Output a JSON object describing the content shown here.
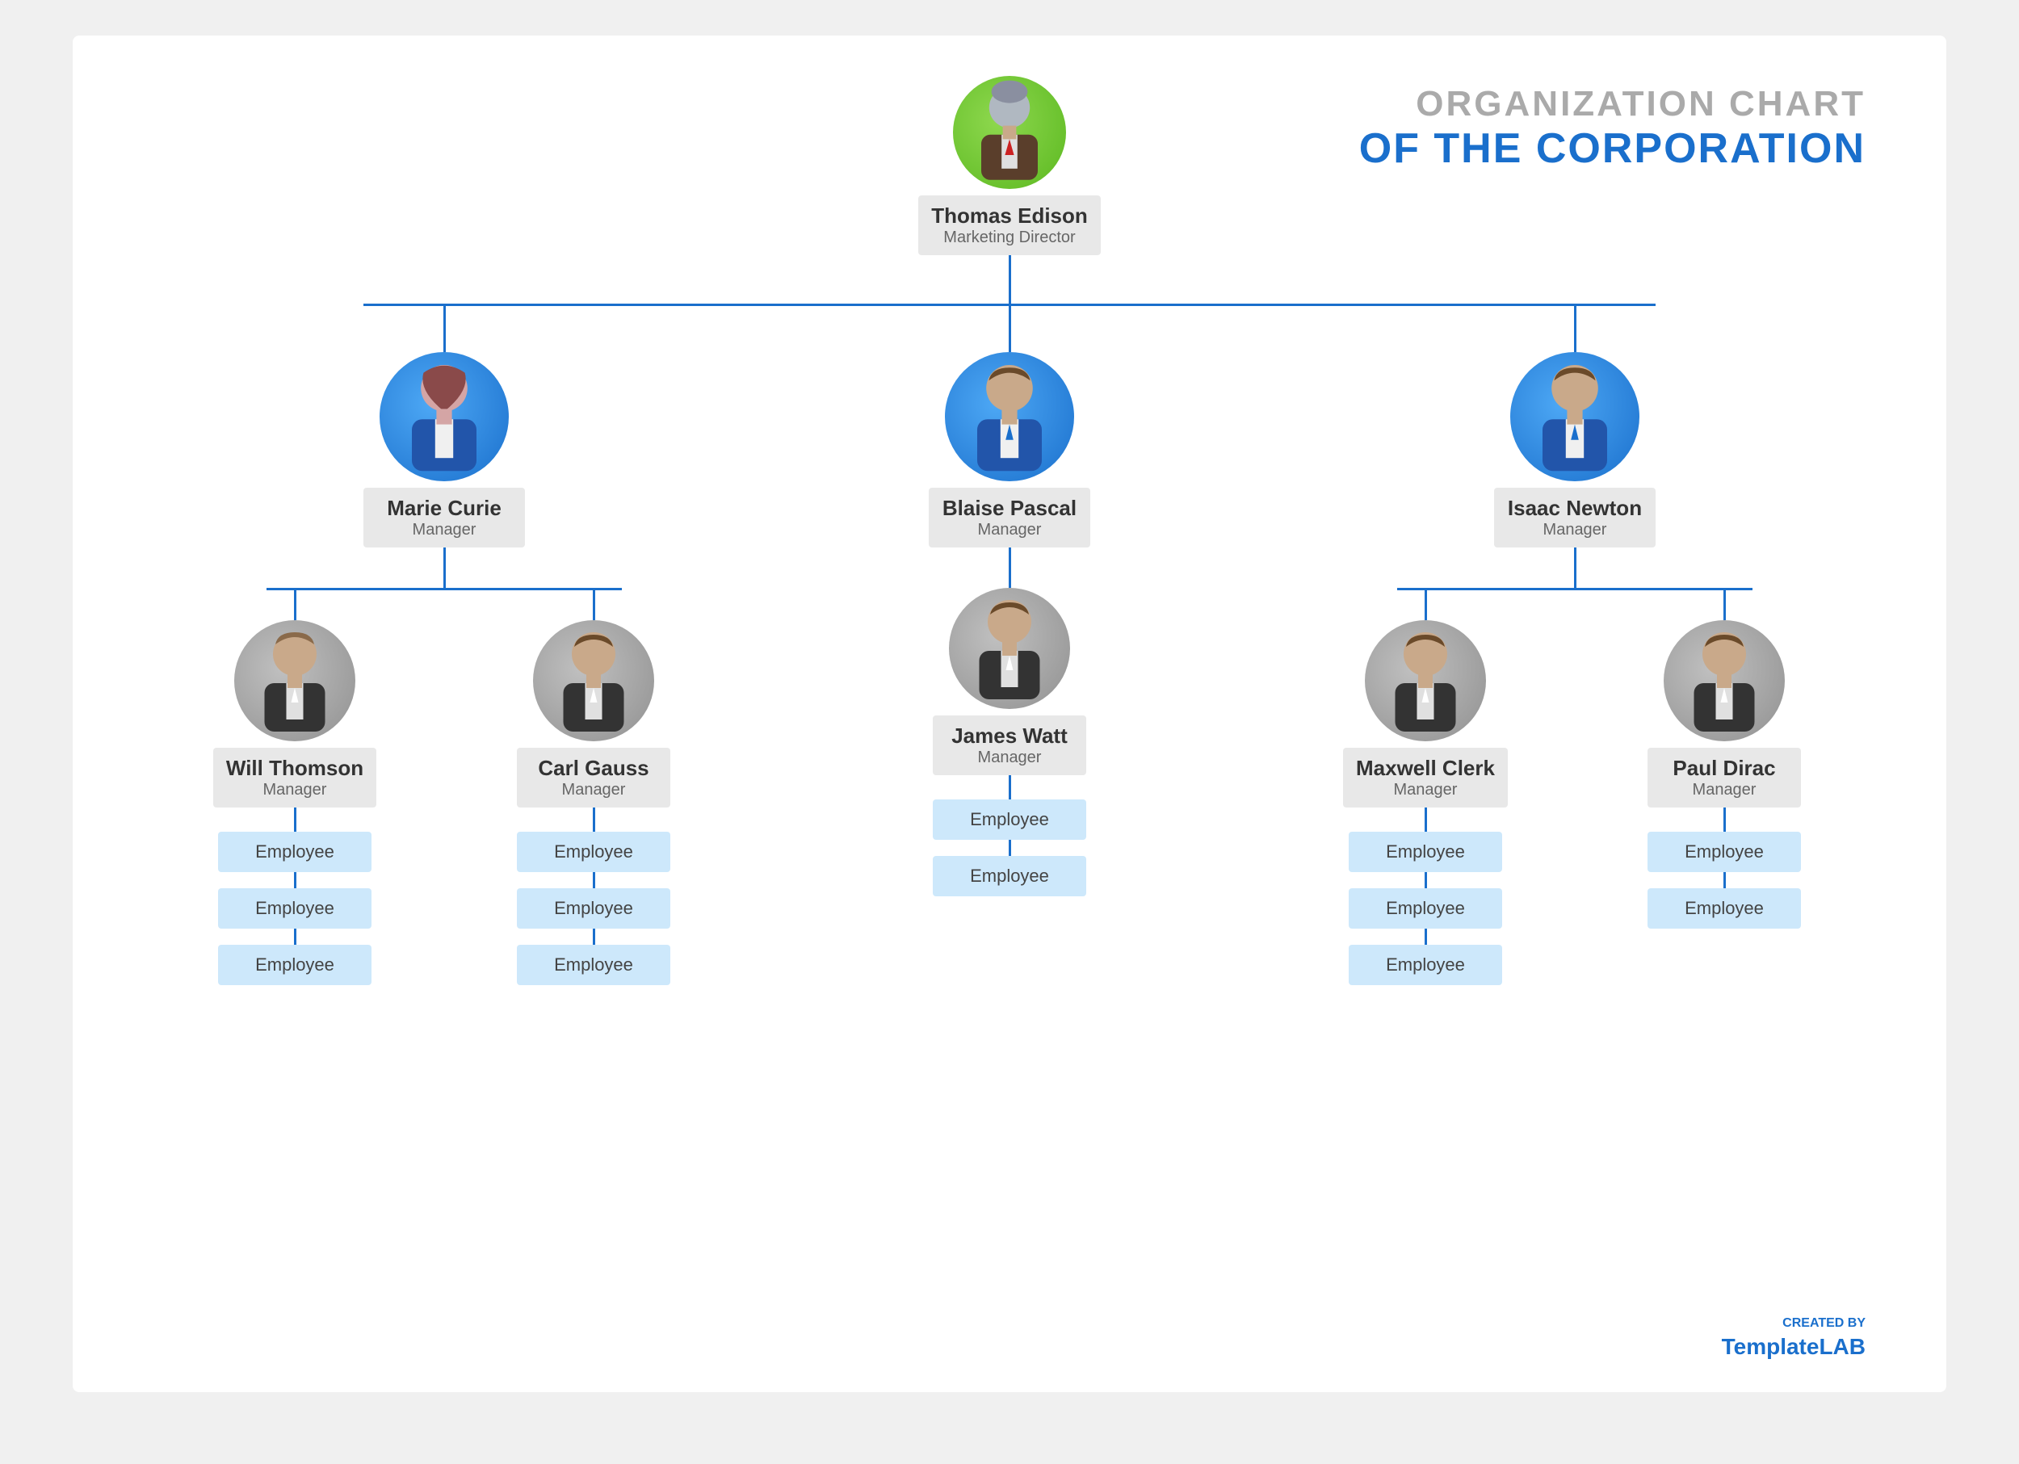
{
  "title": {
    "line1": "ORGANIZATION CHART",
    "line2": "OF THE CORPORATION"
  },
  "branding": {
    "created_by": "CREATED BY",
    "template": "Template",
    "lab": "LAB"
  },
  "ceo": {
    "name": "Thomas Edison",
    "role": "Marketing Director",
    "avatar_type": "green"
  },
  "managers": [
    {
      "name": "Marie Curie",
      "role": "Manager",
      "avatar_type": "blue",
      "gender": "female"
    },
    {
      "name": "Blaise Pascal",
      "role": "Manager",
      "avatar_type": "blue",
      "gender": "male"
    },
    {
      "name": "Isaac Newton",
      "role": "Manager",
      "avatar_type": "blue",
      "gender": "male"
    }
  ],
  "sub_managers": [
    {
      "name": "Will Thomson",
      "role": "Manager",
      "avatar_type": "gray",
      "parent": 0,
      "employees": [
        "Employee",
        "Employee",
        "Employee"
      ]
    },
    {
      "name": "Carl Gauss",
      "role": "Manager",
      "avatar_type": "gray",
      "parent": 0,
      "employees": [
        "Employee",
        "Employee",
        "Employee"
      ]
    },
    {
      "name": "James Watt",
      "role": "Manager",
      "avatar_type": "gray",
      "parent": 1,
      "employees": [
        "Employee",
        "Employee"
      ]
    },
    {
      "name": "Maxwell Clerk",
      "role": "Manager",
      "avatar_type": "gray",
      "parent": 2,
      "employees": [
        "Employee",
        "Employee",
        "Employee"
      ]
    },
    {
      "name": "Paul Dirac",
      "role": "Manager",
      "avatar_type": "gray",
      "parent": 2,
      "employees": [
        "Employee",
        "Employee"
      ]
    }
  ],
  "employee_label": "Employee"
}
